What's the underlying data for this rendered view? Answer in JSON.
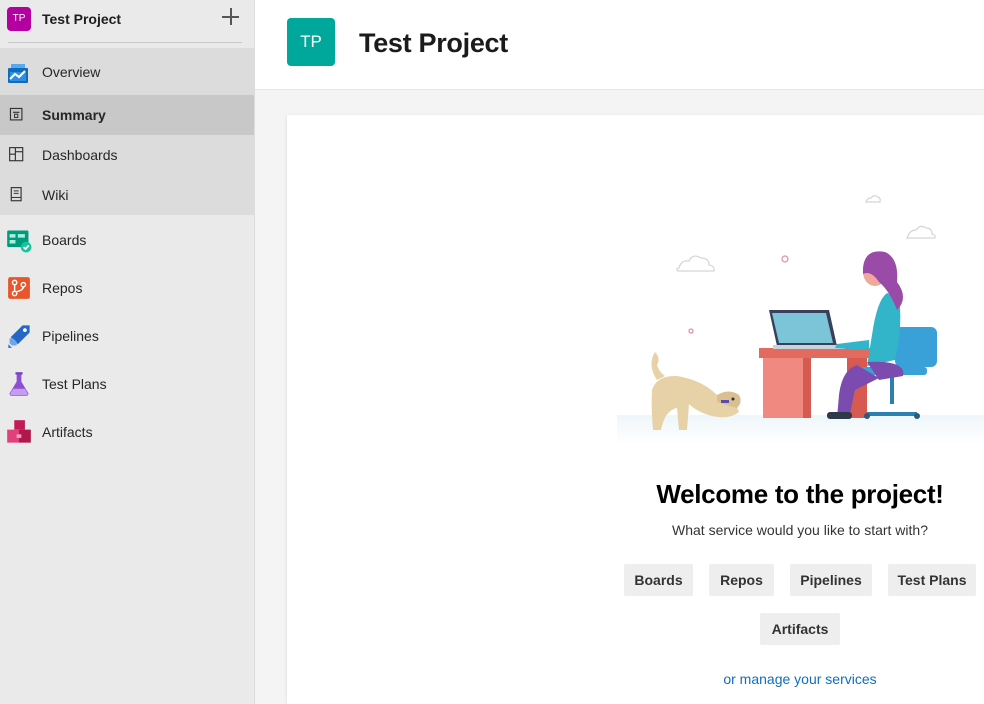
{
  "project": {
    "initials": "TP",
    "name": "Test Project",
    "color_small": "#b4009e",
    "color_header": "#00a89b"
  },
  "sidebar": {
    "add_icon": "plus-icon",
    "items": [
      {
        "label": "Overview",
        "icon": "overview-icon"
      },
      {
        "label": "Summary",
        "icon": "summary-icon",
        "selected": true
      },
      {
        "label": "Dashboards",
        "icon": "dashboards-icon"
      },
      {
        "label": "Wiki",
        "icon": "wiki-icon"
      },
      {
        "label": "Boards",
        "icon": "boards-icon"
      },
      {
        "label": "Repos",
        "icon": "repos-icon"
      },
      {
        "label": "Pipelines",
        "icon": "pipelines-icon"
      },
      {
        "label": "Test Plans",
        "icon": "test-plans-icon"
      },
      {
        "label": "Artifacts",
        "icon": "artifacts-icon"
      }
    ]
  },
  "header": {
    "title": "Test Project"
  },
  "main": {
    "welcome": "Welcome to the project!",
    "subtitle": "What service would you like to start with?",
    "services": [
      "Boards",
      "Repos",
      "Pipelines",
      "Test Plans",
      "Artifacts"
    ],
    "manage_link": "or manage your services"
  }
}
